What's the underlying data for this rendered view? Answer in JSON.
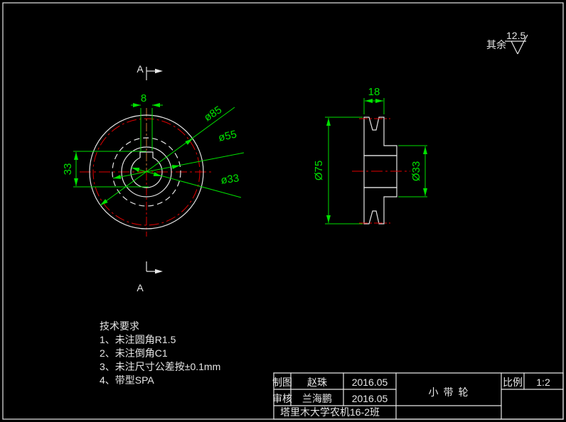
{
  "surface_note": {
    "prefix": "其余",
    "roughness_value": "12.5"
  },
  "front_view": {
    "section_label_top": "A",
    "section_label_bottom": "A",
    "dims": {
      "keyway_width": "8",
      "keyway_depth": "33",
      "outer_dia": "ø85",
      "groove_dia": "ø55",
      "bore_dia": "ø33"
    }
  },
  "side_view": {
    "dims": {
      "rim_width": "18",
      "outer_dia": "Ø75",
      "hub_dia": "Ø33"
    }
  },
  "tech_requirements": {
    "title": "技术要求",
    "items": [
      "1、未注圆角R1.5",
      "2、未注倒角C1",
      "3、未注尺寸公差按±0.1mm",
      "4、带型SPA"
    ]
  },
  "title_block": {
    "drawn_label": "制图",
    "drawn_by": "赵珠",
    "drawn_date": "2016.05",
    "checked_label": "审核",
    "checked_by": "兰海鹏",
    "checked_date": "2016.05",
    "organization": "塔里木大学农机16-2班",
    "part_name": "小带轮",
    "scale_label": "比例",
    "scale_value": "1:2"
  },
  "colors": {
    "background": "#000000",
    "dimension_green": "#00e100",
    "centerline_red": "#e00000",
    "keyway_centerline_orange": "#c87832",
    "outline_white": "#e6e6e6"
  }
}
